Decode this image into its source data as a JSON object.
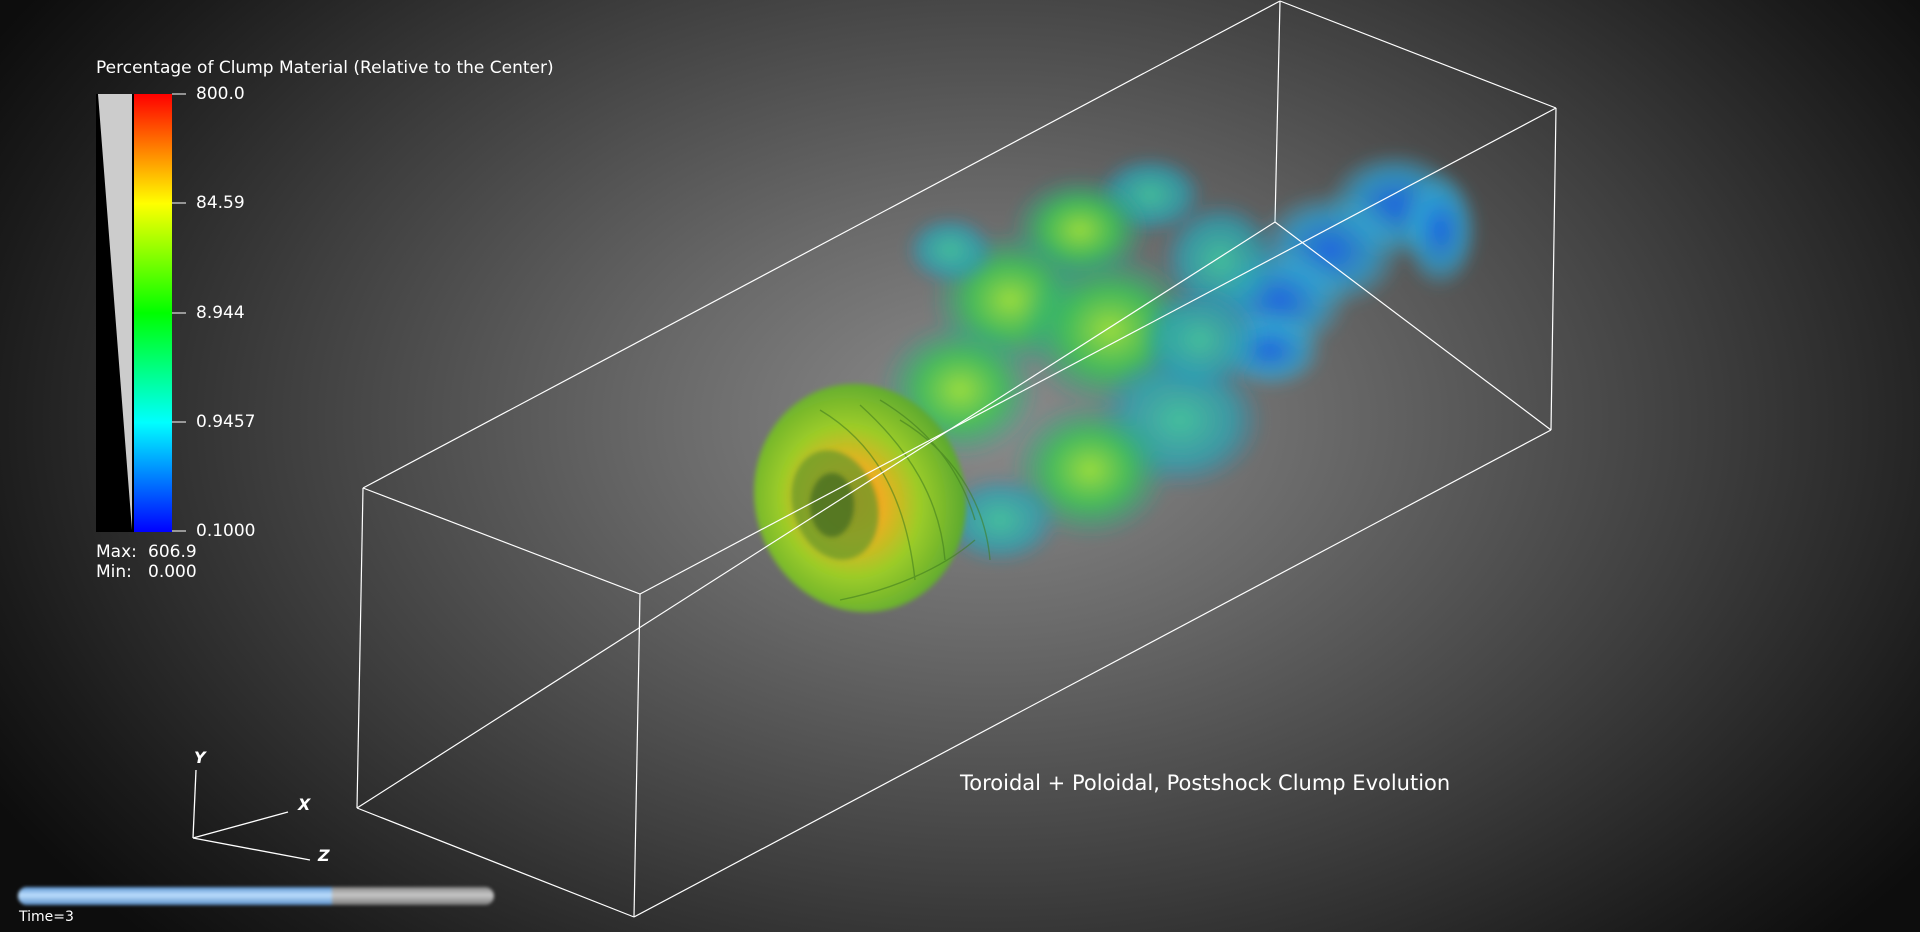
{
  "legend": {
    "title": "Percentage of Clump Material (Relative to the Center)",
    "ticks": [
      "800.0",
      "84.59",
      "8.944",
      "0.9457",
      "0.1000"
    ],
    "max_label": "Max:",
    "max_value": "606.9",
    "min_label": "Min:",
    "min_value": "0.000",
    "colormap": [
      "#0000ff",
      "#0080ff",
      "#00ffff",
      "#00ff80",
      "#00ff00",
      "#80ff00",
      "#ffff00",
      "#ff8000",
      "#ff0000"
    ]
  },
  "caption": "Toroidal + Poloidal, Postshock Clump Evolution",
  "axes": {
    "y": "Y",
    "x": "X",
    "z": "Z"
  },
  "time": {
    "label": "Time=3",
    "progress": 0.66
  },
  "colors": {
    "background_center": "#8c8c8c",
    "background_edge": "#0d0d0d",
    "bounding_box": "#ffffff",
    "slider_fill": "#8fc0f0"
  }
}
